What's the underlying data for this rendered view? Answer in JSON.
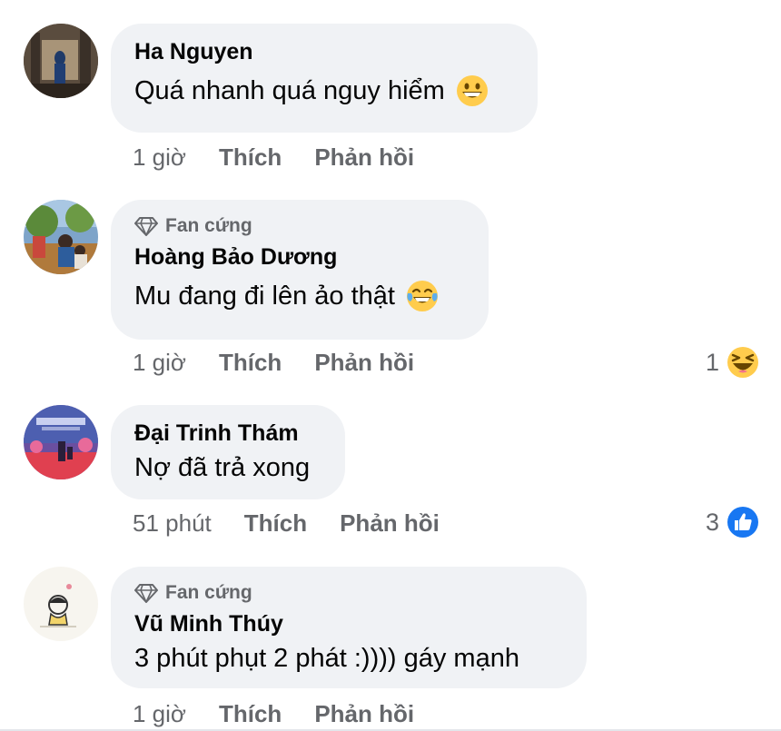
{
  "comments": [
    {
      "name": "Ha Nguyen",
      "badge": "",
      "text": "Quá nhanh quá nguy hiểm",
      "emoji": "grinning-emoji",
      "time": "1 giờ",
      "like_label": "Thích",
      "reply_label": "Phản hồi",
      "reaction_count": "",
      "reaction_icon": ""
    },
    {
      "name": "Hoàng Bảo Dương",
      "badge": "Fan cứng",
      "text": "Mu đang đi lên ảo thật",
      "emoji": "tears-of-joy-emoji",
      "time": "1 giờ",
      "like_label": "Thích",
      "reply_label": "Phản hồi",
      "reaction_count": "1",
      "reaction_icon": "haha-reaction-icon"
    },
    {
      "name": "Đại Trinh Thám",
      "badge": "",
      "text": "Nợ đã trả xong",
      "emoji": "",
      "time": "51 phút",
      "like_label": "Thích",
      "reply_label": "Phản hồi",
      "reaction_count": "3",
      "reaction_icon": "like-reaction-icon"
    },
    {
      "name": "Vũ Minh Thúy",
      "badge": "Fan cứng",
      "text": "3 phút phụt 2 phát :)))) gáy mạnh",
      "emoji": "",
      "time": "1 giờ",
      "like_label": "Thích",
      "reply_label": "Phản hồi",
      "reaction_count": "",
      "reaction_icon": ""
    }
  ],
  "colors": {
    "bubble": "#f0f2f5",
    "text": "#050505",
    "meta": "#65676b",
    "like_blue": "#1877f2",
    "emoji_yellow": "#ffcc4d"
  }
}
